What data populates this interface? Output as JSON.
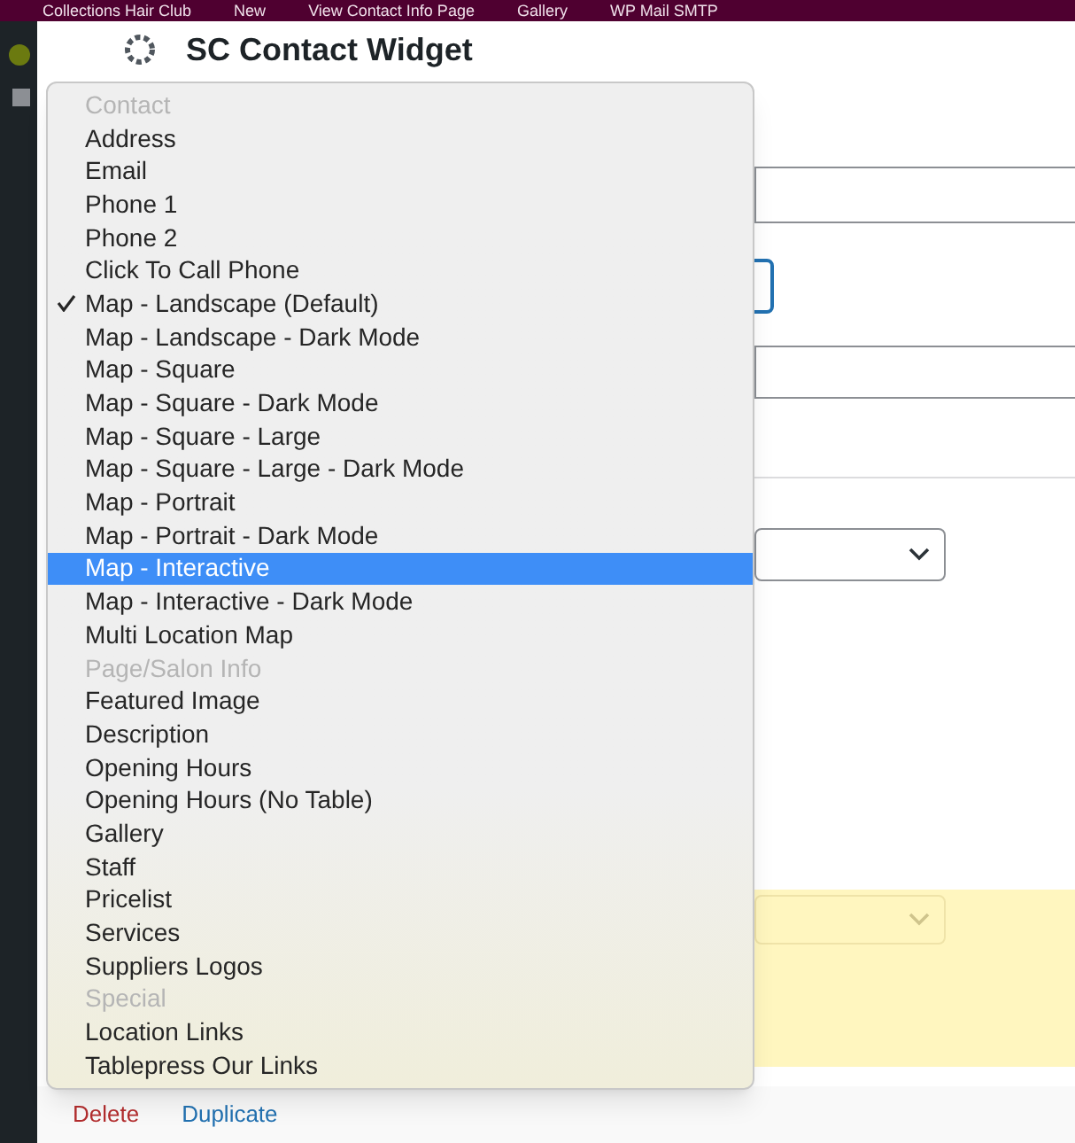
{
  "admin_bar": {
    "items": [
      "Collections Hair Club",
      "New",
      "View Contact Info Page",
      "Gallery",
      "WP Mail SMTP"
    ]
  },
  "widget": {
    "title": "SC Contact Widget"
  },
  "dropdown": {
    "items": [
      {
        "kind": "group",
        "label": "Contact"
      },
      {
        "kind": "option",
        "label": "Address",
        "checked": false,
        "selected": false
      },
      {
        "kind": "option",
        "label": "Email",
        "checked": false,
        "selected": false
      },
      {
        "kind": "option",
        "label": "Phone 1",
        "checked": false,
        "selected": false
      },
      {
        "kind": "option",
        "label": "Phone 2",
        "checked": false,
        "selected": false
      },
      {
        "kind": "option",
        "label": "Click To Call Phone",
        "checked": false,
        "selected": false
      },
      {
        "kind": "option",
        "label": "Map - Landscape (Default)",
        "checked": true,
        "selected": false
      },
      {
        "kind": "option",
        "label": "Map - Landscape - Dark Mode",
        "checked": false,
        "selected": false
      },
      {
        "kind": "option",
        "label": "Map - Square",
        "checked": false,
        "selected": false
      },
      {
        "kind": "option",
        "label": "Map - Square - Dark Mode",
        "checked": false,
        "selected": false
      },
      {
        "kind": "option",
        "label": "Map - Square - Large",
        "checked": false,
        "selected": false
      },
      {
        "kind": "option",
        "label": "Map - Square - Large - Dark Mode",
        "checked": false,
        "selected": false
      },
      {
        "kind": "option",
        "label": "Map - Portrait",
        "checked": false,
        "selected": false
      },
      {
        "kind": "option",
        "label": "Map - Portrait - Dark Mode",
        "checked": false,
        "selected": false
      },
      {
        "kind": "option",
        "label": "Map - Interactive",
        "checked": false,
        "selected": true
      },
      {
        "kind": "option",
        "label": "Map - Interactive - Dark Mode",
        "checked": false,
        "selected": false
      },
      {
        "kind": "option",
        "label": "Multi Location Map",
        "checked": false,
        "selected": false
      },
      {
        "kind": "group",
        "label": "Page/Salon Info"
      },
      {
        "kind": "option",
        "label": "Featured Image",
        "checked": false,
        "selected": false
      },
      {
        "kind": "option",
        "label": "Description",
        "checked": false,
        "selected": false
      },
      {
        "kind": "option",
        "label": "Opening Hours",
        "checked": false,
        "selected": false
      },
      {
        "kind": "option",
        "label": "Opening Hours (No Table)",
        "checked": false,
        "selected": false
      },
      {
        "kind": "option",
        "label": "Gallery",
        "checked": false,
        "selected": false
      },
      {
        "kind": "option",
        "label": "Staff",
        "checked": false,
        "selected": false
      },
      {
        "kind": "option",
        "label": "Pricelist",
        "checked": false,
        "selected": false
      },
      {
        "kind": "option",
        "label": "Services",
        "checked": false,
        "selected": false
      },
      {
        "kind": "option",
        "label": "Suppliers Logos",
        "checked": false,
        "selected": false
      },
      {
        "kind": "group",
        "label": "Special"
      },
      {
        "kind": "option",
        "label": "Location Links",
        "checked": false,
        "selected": false
      },
      {
        "kind": "option",
        "label": "Tablepress Our Links",
        "checked": false,
        "selected": false
      }
    ]
  },
  "footer_links": [
    {
      "kind": "danger",
      "label": "Delete"
    },
    {
      "kind": "normal",
      "label": "Duplicate"
    }
  ]
}
